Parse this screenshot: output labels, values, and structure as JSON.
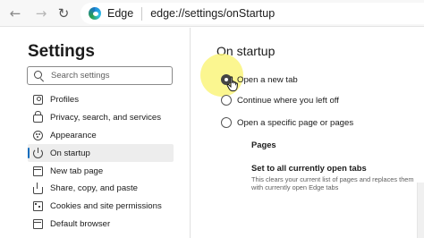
{
  "browser": {
    "back_icon": "back-arrow-icon",
    "forward_icon": "forward-arrow-icon",
    "reload_icon": "reload-icon",
    "logo_icon": "edge-logo-icon",
    "name": "Edge",
    "url": "edge://settings/onStartup"
  },
  "sidebar": {
    "title": "Settings",
    "search": {
      "placeholder": "Search settings"
    },
    "items": [
      {
        "label": "Profiles",
        "icon": "profile-icon"
      },
      {
        "label": "Privacy, search, and services",
        "icon": "lock-icon"
      },
      {
        "label": "Appearance",
        "icon": "palette-icon"
      },
      {
        "label": "On startup",
        "icon": "power-icon",
        "active": true
      },
      {
        "label": "New tab page",
        "icon": "new-tab-icon"
      },
      {
        "label": "Share, copy, and paste",
        "icon": "share-icon"
      },
      {
        "label": "Cookies and site permissions",
        "icon": "cookies-icon"
      },
      {
        "label": "Default browser",
        "icon": "browser-icon"
      }
    ]
  },
  "main": {
    "title": "On startup",
    "options": [
      {
        "label": "Open a new tab",
        "checked": true
      },
      {
        "label": "Continue where you left off",
        "checked": false
      },
      {
        "label": "Open a specific page or pages",
        "checked": false
      }
    ],
    "pages_label": "Pages",
    "set_tabs_label": "Set to all currently open tabs",
    "set_tabs_desc": "This clears your current list of pages and replaces them with currently open Edge tabs"
  },
  "colors": {
    "accent": "#0f6cbd",
    "highlight": "#faf478"
  }
}
